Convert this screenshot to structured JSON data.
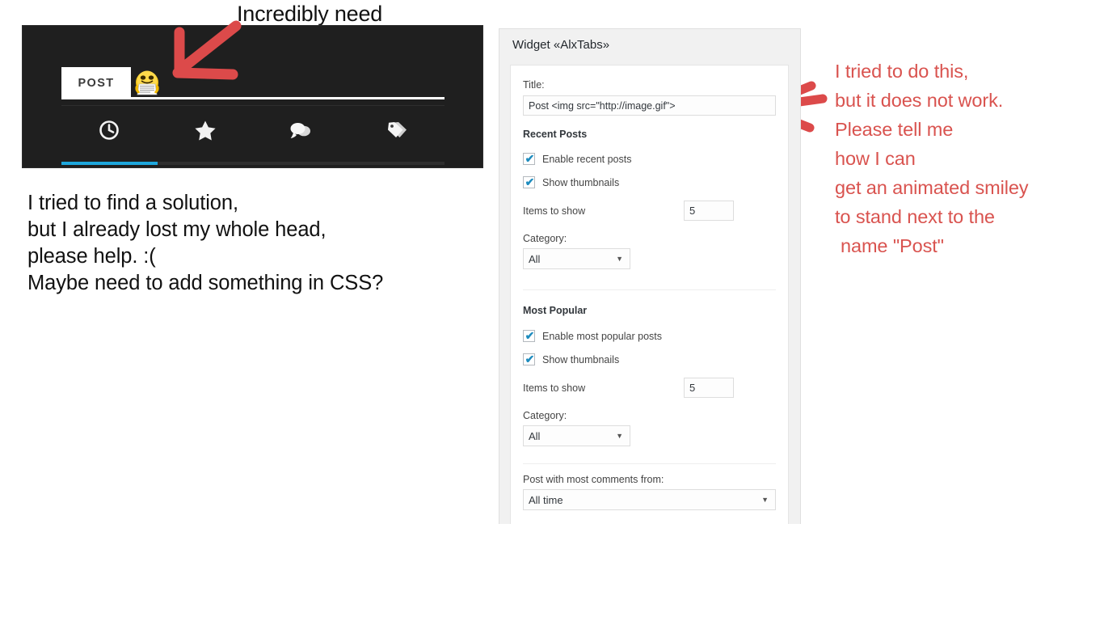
{
  "heading": "Incredibly need",
  "preview": {
    "tab_label": "POST",
    "smiley_icon": "smiley-reading-newspaper-icon",
    "icons": [
      {
        "name": "clock-icon",
        "label": "Recent"
      },
      {
        "name": "star-icon",
        "label": "Popular"
      },
      {
        "name": "comments-icon",
        "label": "Comments"
      },
      {
        "name": "tags-icon",
        "label": "Tags"
      }
    ],
    "active_underline_color": "#1ea7dd",
    "background_color": "#1f1f1f"
  },
  "body_note": [
    "I tried to find a solution,",
    "but I already lost my whole head,",
    "please help. :(",
    "Maybe need to add something in CSS?"
  ],
  "red_note": {
    "color": "#d9534f",
    "lines": [
      "I tried to do this,",
      "but it does not work.",
      "Please tell me",
      "how I can",
      "get an animated smiley",
      "to stand next to the",
      " name \"Post\""
    ]
  },
  "widget": {
    "panel_title": "Widget «AlxTabs»",
    "title_field": {
      "label": "Title:",
      "value": "Post <img src=\"http://image.gif\">"
    },
    "recent_posts": {
      "section_label": "Recent Posts",
      "enable": {
        "label": "Enable recent posts",
        "checked": true
      },
      "thumbnails": {
        "label": "Show thumbnails",
        "checked": true
      },
      "items_to_show": {
        "label": "Items to show",
        "value": "5"
      },
      "category": {
        "label": "Category:",
        "value": "All"
      }
    },
    "most_popular": {
      "section_label": "Most Popular",
      "enable": {
        "label": "Enable most popular posts",
        "checked": true
      },
      "thumbnails": {
        "label": "Show thumbnails",
        "checked": true
      },
      "items_to_show": {
        "label": "Items to show",
        "value": "5"
      },
      "category": {
        "label": "Category:",
        "value": "All"
      },
      "comments_from": {
        "label": "Post with most comments from:",
        "value": "All time"
      }
    },
    "checkmark_glyph": "✔",
    "caret_glyph": "▼"
  }
}
